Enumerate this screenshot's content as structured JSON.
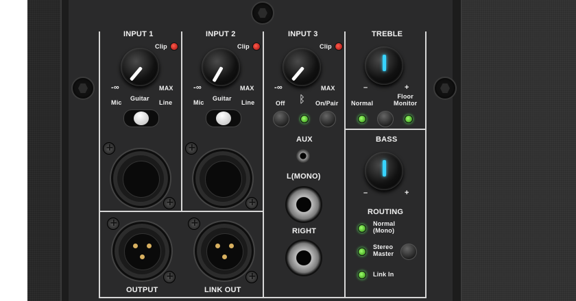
{
  "inputs": [
    {
      "label": "INPUT 1",
      "clip": "Clip",
      "min": "-∞",
      "max": "MAX",
      "sw_mic": "Mic",
      "sw_guitar": "Guitar",
      "sw_line": "Line"
    },
    {
      "label": "INPUT 2",
      "clip": "Clip",
      "min": "-∞",
      "max": "MAX",
      "sw_mic": "Mic",
      "sw_guitar": "Guitar",
      "sw_line": "Line"
    },
    {
      "label": "INPUT 3",
      "clip": "Clip",
      "min": "-∞",
      "max": "MAX",
      "bt_off": "Off",
      "bt_pair": "On/Pair"
    }
  ],
  "treble": {
    "label": "TREBLE",
    "minus": "–",
    "plus": "+",
    "normal": "Normal",
    "floor_monitor": "Floor\nMonitor"
  },
  "bass": {
    "label": "BASS",
    "minus": "–",
    "plus": "+"
  },
  "routing": {
    "label": "ROUTING",
    "normal_mono": "Normal\n(Mono)",
    "stereo_master": "Stereo\nMaster",
    "link_in": "Link In"
  },
  "jacks": {
    "aux": "AUX",
    "left": "L(MONO)",
    "right": "RIGHT"
  },
  "outputs": {
    "output": "OUTPUT",
    "link_out": "LINK OUT"
  },
  "colors": {
    "clip_led": "#e02a20",
    "status_led": "#5fd93a",
    "accent_pointer": "#37d4ff",
    "panel": "#2a2a2b",
    "lines": "#d8d8d8"
  },
  "icons": {
    "bluetooth": "bluetooth-icon"
  }
}
